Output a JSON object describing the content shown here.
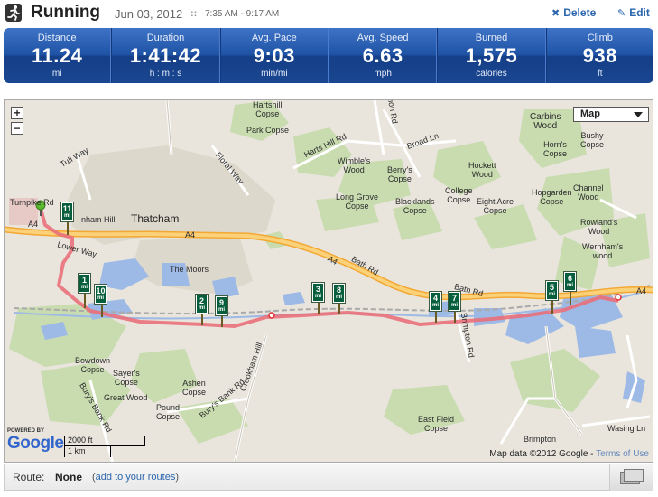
{
  "header": {
    "title": "Running",
    "date": "Jun 03, 2012",
    "date_separator": "::",
    "time_range": "7:35 AM - 9:17 AM",
    "delete_label": "Delete",
    "edit_label": "Edit",
    "icons": {
      "activity": "runner-icon",
      "delete": "x-icon",
      "edit": "pencil-icon"
    },
    "accent_color": "#2a65ad"
  },
  "stats": [
    {
      "label": "Distance",
      "value": "11.24",
      "unit": "mi"
    },
    {
      "label": "Duration",
      "value": "1:41:42",
      "unit": "h : m : s"
    },
    {
      "label": "Avg. Pace",
      "value": "9:03",
      "unit": "min/mi"
    },
    {
      "label": "Avg. Speed",
      "value": "6.63",
      "unit": "mph"
    },
    {
      "label": "Burned",
      "value": "1,575",
      "unit": "calories"
    },
    {
      "label": "Climb",
      "value": "938",
      "unit": "ft"
    }
  ],
  "map": {
    "type_selector": "Map",
    "zoom_in": "+",
    "zoom_out": "−",
    "town": "Thatcham",
    "labels": {
      "tull_way": "Tull Way",
      "turnpike_rd": "Turnpike Rd",
      "a4_west": "A4",
      "a4_mid": "A4",
      "a4_bath": "A4",
      "a4_east": "A4",
      "hill": "nham Hill",
      "lower_way": "Lower Way",
      "the_moors": "The Moors",
      "floral_way": "Floral Way",
      "hartshill": "Hartshill\nCopse",
      "park_copse": "Park Copse",
      "harts_hill_rd": "Harts Hill Rd",
      "broad_ln": "Broad Ln",
      "carbins_wood": "Carbins\nWood",
      "horns_copse": "Horn's\nCopse",
      "bushy_copse": "Bushy\nCopse",
      "wimbles_wood": "Wimble's\nWood",
      "berrys_copse": "Berry's\nCopse",
      "hockett_wood": "Hockett\nWood",
      "long_grove": "Long Grove\nCopse",
      "blacklands": "Blacklands\nCopse",
      "college_copse": "College\nCopse",
      "eight_acre": "Eight Acre\nCopse",
      "hopgarden": "Hopgarden\nCopse",
      "channel_wood": "Channel\nWood",
      "rowlands_wood": "Rowland's\nWood",
      "wernhams_wood": "Wernham's\nwood",
      "bath_rd_1": "Bath Rd",
      "bath_rd_2": "Bath Rd",
      "bowdown": "Bowdown\nCopse",
      "sayers": "Sayer's\nCopse",
      "great_wood": "Great Wood",
      "ashen": "Ashen\nCopse",
      "pound": "Pound\nCopse",
      "burys_bank_1": "Bury's Bank Rd",
      "burys_bank_2": "Bury's Bank Rd",
      "crookham_hill": "Crookham Hill",
      "east_field": "East Field\nCopse",
      "brimpton": "Brimpton",
      "wasing_ln": "Wasing Ln",
      "station_rd": "Station Rd",
      "brimpton_rd": "Brimpton Rd"
    },
    "mile_markers": [
      "1",
      "2",
      "3",
      "4",
      "5",
      "6",
      "7",
      "8",
      "9",
      "10",
      "11"
    ],
    "marker_unit": "mi",
    "scale_ft": "2000 ft",
    "scale_km": "1 km",
    "powered_by": "POWERED BY",
    "logo_text": "Google",
    "attribution": "Map data ©2012 Google - ",
    "terms_link": "Terms of Use",
    "route_color": "#e9707a",
    "a4_color": "#f6b445"
  },
  "route_bar": {
    "label": "Route:",
    "value": "None",
    "paren_open": "(",
    "link_text": "add to your routes",
    "paren_close": ")",
    "icons": {
      "fullscreen": "fullscreen-icon"
    }
  }
}
